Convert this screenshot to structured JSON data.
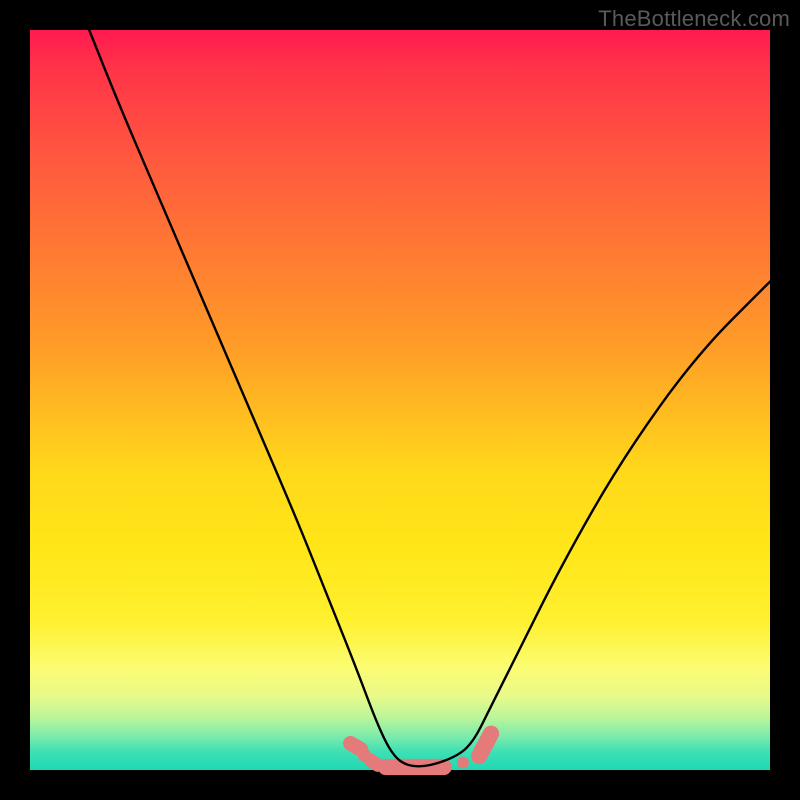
{
  "watermark": "TheBottleneck.com",
  "chart_data": {
    "type": "line",
    "title": "",
    "xlabel": "",
    "ylabel": "",
    "xlim": [
      0,
      100
    ],
    "ylim": [
      0,
      100
    ],
    "series": [
      {
        "name": "curve",
        "x": [
          8,
          12,
          18,
          24,
          30,
          36,
          40,
          44,
          47,
          49,
          51,
          54,
          58,
          60,
          62,
          66,
          72,
          80,
          90,
          100
        ],
        "y": [
          100,
          90,
          76,
          62,
          48,
          34,
          24,
          14,
          6,
          2,
          0.5,
          0.5,
          2,
          4,
          8,
          16,
          28,
          42,
          56,
          66
        ],
        "stroke": "#000000",
        "width": 2.4
      }
    ],
    "markers": [
      {
        "shape": "pill",
        "cx": 44.0,
        "cy": 3.2,
        "rx": 1.0,
        "ry": 1.8,
        "angle": -60,
        "fill": "#e47a7a"
      },
      {
        "shape": "circle",
        "cx": 45.2,
        "cy": 2.0,
        "r": 0.9,
        "fill": "#e47a7a"
      },
      {
        "shape": "pill",
        "cx": 46.5,
        "cy": 1.0,
        "rx": 0.9,
        "ry": 1.5,
        "angle": -55,
        "fill": "#e47a7a"
      },
      {
        "shape": "pill",
        "cx": 52.0,
        "cy": 0.4,
        "rx": 5.0,
        "ry": 1.1,
        "angle": 0,
        "fill": "#e47a7a"
      },
      {
        "shape": "circle",
        "cx": 58.5,
        "cy": 1.0,
        "r": 0.8,
        "fill": "#e47a7a"
      },
      {
        "shape": "pill",
        "cx": 61.5,
        "cy": 3.4,
        "rx": 1.1,
        "ry": 2.8,
        "angle": 28,
        "fill": "#e47a7a"
      }
    ],
    "gradient_stops": [
      {
        "pct": 0,
        "color": "#ff1a50"
      },
      {
        "pct": 60,
        "color": "#ffd91a"
      },
      {
        "pct": 90,
        "color": "#e8fa8a"
      },
      {
        "pct": 100,
        "color": "#1ed9b4"
      }
    ]
  }
}
